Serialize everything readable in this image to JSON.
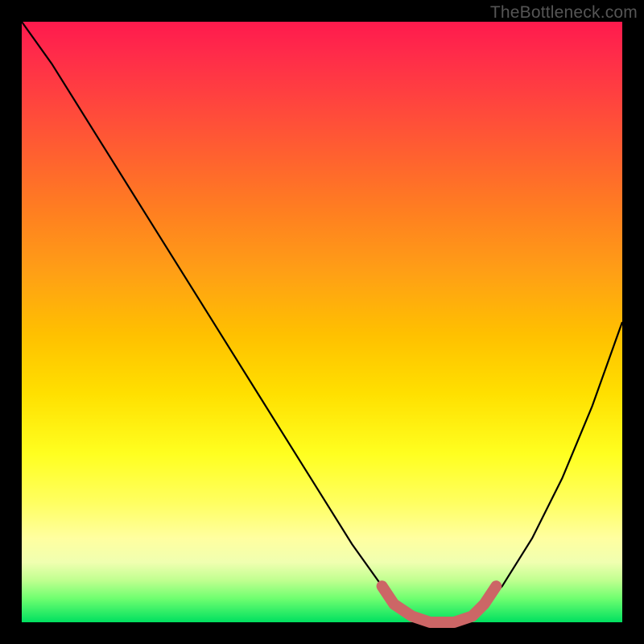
{
  "watermark": "TheBottleneck.com",
  "chart_data": {
    "type": "line",
    "title": "",
    "xlabel": "",
    "ylabel": "",
    "xlim": [
      0,
      100
    ],
    "ylim": [
      0,
      100
    ],
    "grid": false,
    "series": [
      {
        "name": "bottleneck-curve",
        "color": "#000000",
        "x": [
          0,
          5,
          10,
          15,
          20,
          25,
          30,
          35,
          40,
          45,
          50,
          55,
          60,
          62,
          65,
          68,
          72,
          76,
          80,
          85,
          90,
          95,
          100
        ],
        "y": [
          100,
          93,
          85,
          77,
          69,
          61,
          53,
          45,
          37,
          29,
          21,
          13,
          6,
          3,
          1,
          0,
          0,
          2,
          6,
          14,
          24,
          36,
          50
        ]
      },
      {
        "name": "optimal-zone-marker",
        "color": "#cc6666",
        "x": [
          60,
          62,
          65,
          68,
          72,
          75,
          77,
          79
        ],
        "y": [
          6,
          3,
          1,
          0,
          0,
          1,
          3,
          6
        ]
      }
    ],
    "gradient_stops": [
      {
        "pos": 0,
        "color": "#ff1a4d"
      },
      {
        "pos": 50,
        "color": "#ffc000"
      },
      {
        "pos": 75,
        "color": "#ffff30"
      },
      {
        "pos": 100,
        "color": "#00e060"
      }
    ]
  }
}
